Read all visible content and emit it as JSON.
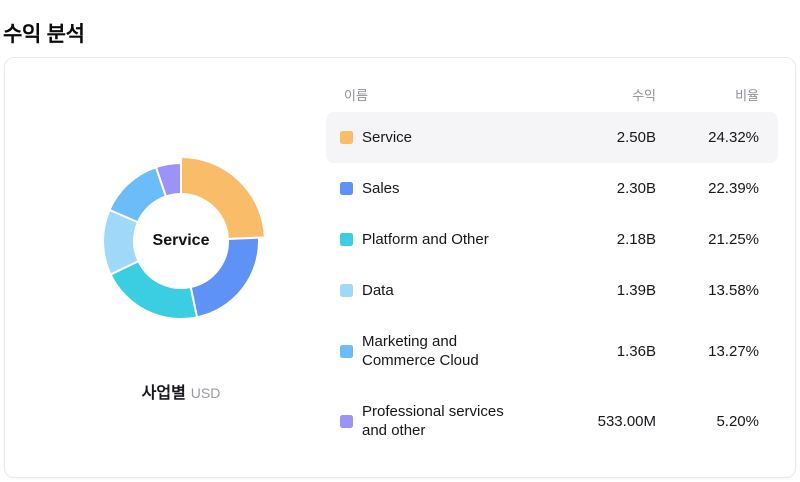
{
  "page": {
    "title": "수익 분석"
  },
  "theme": {
    "card_border": "#E7E7F0",
    "highlight_row_bg": "#F5F5F7",
    "header_text": "#8F8F98"
  },
  "chart": {
    "center_label": "Service",
    "footer_label": "사업별",
    "footer_unit": "USD"
  },
  "table": {
    "headers": {
      "name": "이름",
      "revenue": "수익",
      "ratio": "비율"
    },
    "rows": [
      {
        "name": "Service",
        "revenue": "2.50B",
        "ratio": "24.32%",
        "color": "#F9BC69",
        "highlighted": true
      },
      {
        "name": "Sales",
        "revenue": "2.30B",
        "ratio": "22.39%",
        "color": "#5E92F6",
        "highlighted": false
      },
      {
        "name": "Platform and Other",
        "revenue": "2.18B",
        "ratio": "21.25%",
        "color": "#3BCDE1",
        "highlighted": false
      },
      {
        "name": "Data",
        "revenue": "1.39B",
        "ratio": "13.58%",
        "color": "#9FD8F8",
        "highlighted": false
      },
      {
        "name": "Marketing and\nCommerce Cloud",
        "revenue": "1.36B",
        "ratio": "13.27%",
        "color": "#6ABDF8",
        "highlighted": false
      },
      {
        "name": "Professional services\nand other",
        "revenue": "533.00M",
        "ratio": "5.20%",
        "color": "#9B93F7",
        "highlighted": false
      }
    ]
  },
  "chart_data": {
    "type": "pie",
    "donut": true,
    "title": "수익 분석",
    "subtitle": "사업별 (USD)",
    "unit": "USD",
    "categories": [
      "Service",
      "Sales",
      "Platform and Other",
      "Data",
      "Marketing and Commerce Cloud",
      "Professional services and other"
    ],
    "values": [
      2.5,
      2.3,
      2.18,
      1.39,
      1.36,
      0.533
    ],
    "value_labels": [
      "2.50B",
      "2.30B",
      "2.18B",
      "1.39B",
      "1.36B",
      "533.00M"
    ],
    "percents": [
      24.32,
      22.39,
      21.25,
      13.58,
      13.27,
      5.2
    ],
    "colors": [
      "#F9BC69",
      "#5E92F6",
      "#3BCDE1",
      "#9FD8F8",
      "#6ABDF8",
      "#9B93F7"
    ],
    "selected_category": "Service",
    "start_angle_deg": 0,
    "legend_position": "right-table"
  }
}
